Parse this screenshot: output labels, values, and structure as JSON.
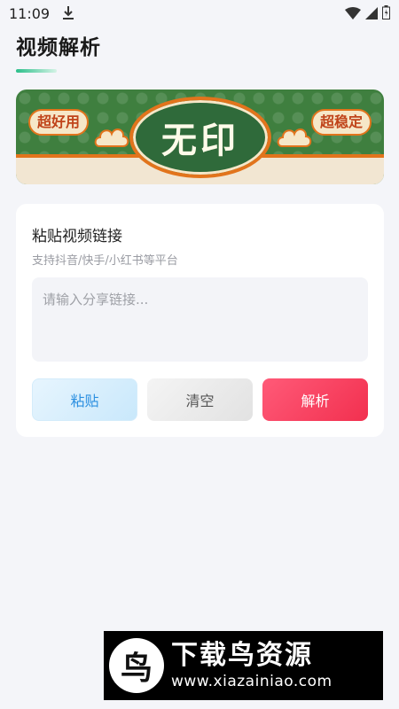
{
  "status_bar": {
    "time": "11:09",
    "icons": [
      "download-icon",
      "wifi-icon",
      "signal-icon",
      "battery-icon"
    ]
  },
  "header": {
    "title": "视频解析",
    "underline_color": "#2bbf8a"
  },
  "banner": {
    "left_badge": "超好用",
    "center_text": "无印",
    "right_badge": "超稳定",
    "colors": {
      "green": "#3f7f3f",
      "orange": "#e2741c",
      "cream": "#f2e6d2"
    }
  },
  "card": {
    "title": "粘贴视频链接",
    "subtitle": "支持抖音/快手/小红书等平台",
    "input": {
      "value": "",
      "placeholder": "请输入分享链接..."
    },
    "buttons": {
      "paste_label": "粘贴",
      "clear_label": "清空",
      "parse_label": "解析"
    },
    "colors": {
      "paste": "#2b8fe0",
      "parse": "#f2304f"
    }
  },
  "watermark": {
    "title": "下载鸟资源",
    "url": "www.xiazainiao.com"
  }
}
